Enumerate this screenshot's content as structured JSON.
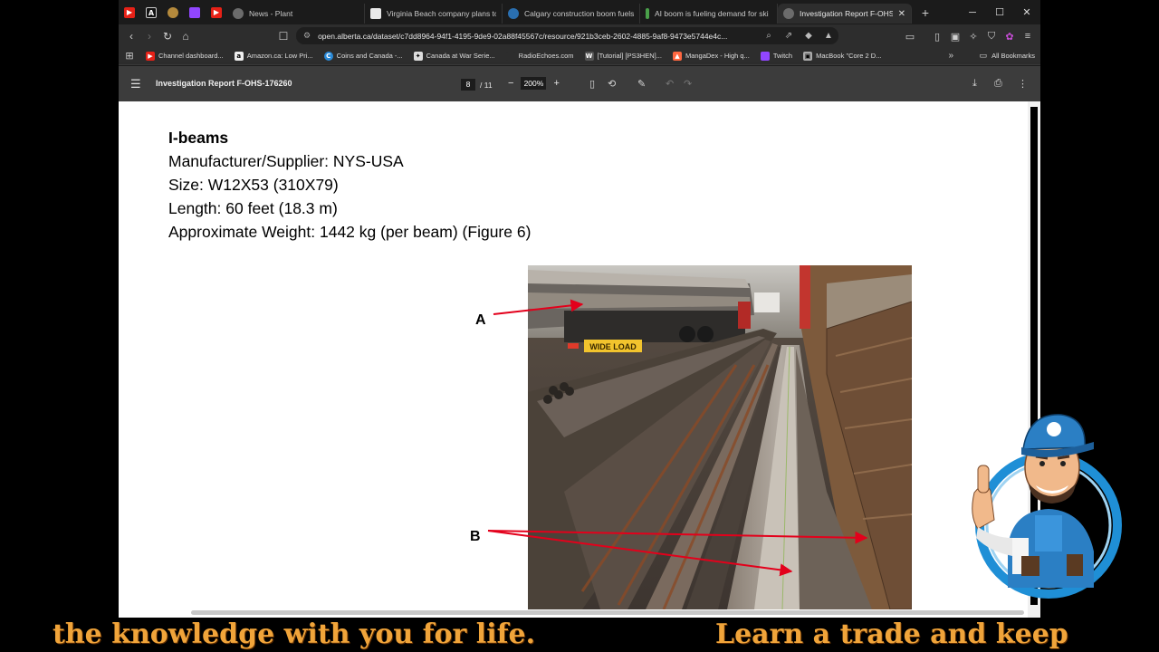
{
  "tabs": {
    "pinned": [
      {
        "name": "youtube-pinned-tab",
        "icon": "youtube-icon",
        "glyph": "▶",
        "color": "#e62117"
      },
      {
        "name": "a-pinned-tab",
        "icon": "letter-a-icon",
        "glyph": "A",
        "color": "#111111"
      },
      {
        "name": "pinned-tab-3",
        "icon": "cookie-icon",
        "glyph": "●",
        "color": "#b58a3c"
      },
      {
        "name": "twitch-pinned-tab",
        "icon": "twitch-icon",
        "glyph": "■",
        "color": "#9146ff"
      },
      {
        "name": "youtube-pinned-tab-2",
        "icon": "youtube-icon",
        "glyph": "▶",
        "color": "#e62117"
      }
    ],
    "items": [
      {
        "label": "News - Plant",
        "icon": "globe-icon",
        "color": "#6b6b6b"
      },
      {
        "label": "Virginia Beach company plans to a",
        "icon": "news-icon",
        "color": "#e8e8e8"
      },
      {
        "label": "Calgary construction boom fuels c",
        "icon": "calgary-icon",
        "color": "#2a6fb0"
      },
      {
        "label": "AI boom is fueling demand for ski",
        "icon": "ai-icon",
        "color": "#4aa04a"
      },
      {
        "label": "Investigation Report F-OHS-",
        "icon": "globe-icon",
        "color": "#6b6b6b"
      }
    ]
  },
  "address_bar": {
    "url": "open.alberta.ca/dataset/c7dd8964-94f1-4195-9de9-02a88f45567c/resource/921b3ceb-2602-4885-9af8-9473e5744e4c..."
  },
  "bookmarks": {
    "items": [
      {
        "label": "Channel dashboard...",
        "color": "#e62117",
        "glyph": "▶"
      },
      {
        "label": "Amazon.ca: Low Pri...",
        "color": "#eeeeee",
        "glyph": "a"
      },
      {
        "label": "Coins and Canada -...",
        "color": "#2a8ad8",
        "glyph": "C"
      },
      {
        "label": "Canada at War Serie...",
        "color": "#dddddd",
        "glyph": "✦"
      },
      {
        "label": "RadioEchoes.com",
        "color": "#2d2d2d",
        "glyph": ""
      },
      {
        "label": "[Tutorial] [PS3HEN]...",
        "color": "#555555",
        "glyph": "W"
      },
      {
        "label": "MangaDex - High q...",
        "color": "#ff6740",
        "glyph": "▲"
      },
      {
        "label": "Twitch",
        "color": "#9146ff",
        "glyph": "■"
      },
      {
        "label": "MacBook \"Core 2 D...",
        "color": "#aaaaaa",
        "glyph": "▣"
      }
    ],
    "all_label": "All Bookmarks"
  },
  "pdf_toolbar": {
    "title": "Investigation Report F-OHS-176260",
    "current_page": "8",
    "total_pages": "/ 11",
    "zoom": "200%"
  },
  "document": {
    "heading": "I-beams",
    "lines": [
      "Manufacturer/Supplier:  NYS-USA",
      "Size: W12X53  (310X79)",
      "Length:  60 feet  (18.3 m)",
      "Approximate Weight: 1442 kg (per beam) (Figure 6)"
    ],
    "callout_a": "A",
    "callout_b": "B",
    "truck_sign": "WIDE LOAD"
  },
  "caption": {
    "left": "the knowledge with you for life.",
    "right": "Learn a trade and keep"
  },
  "colors": {
    "caption_text": "#f0a43a",
    "arrow_red": "#e3001b",
    "pdf_toolbar_bg": "#3c3c3c",
    "tabstrip_bg": "#1b1b1b"
  }
}
